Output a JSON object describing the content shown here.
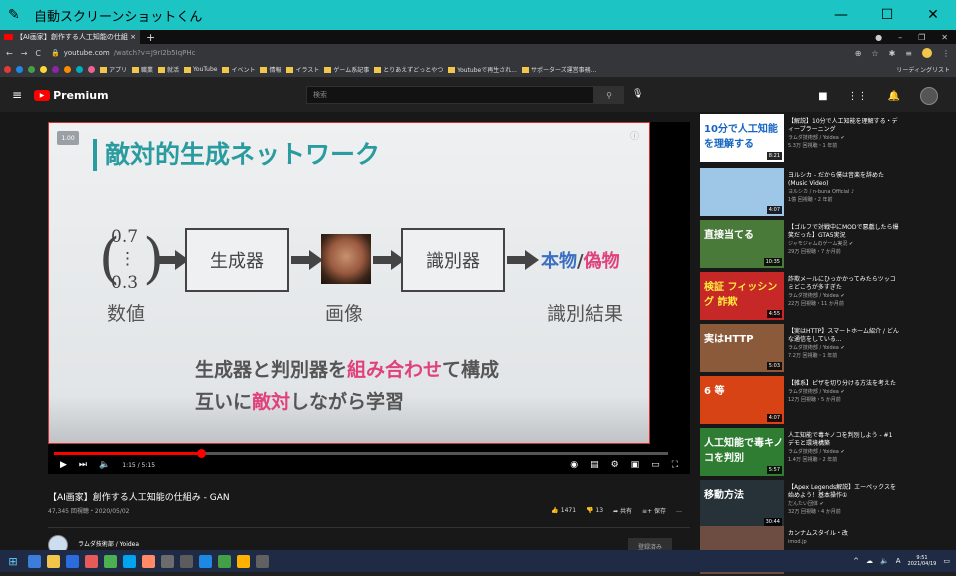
{
  "window": {
    "title": "自動スクリーンショットくん",
    "icon": "feather-icon",
    "minimize": "—",
    "maximize": "☐",
    "close": "✕"
  },
  "browser": {
    "tab_title": "【AI画家】創作する人工知能の仕組 ×",
    "url_domain": "youtube.com",
    "url_path": "/watch?v=J9rI2b5IqPHc",
    "new_tab": "+",
    "bookmarks": [
      "アプリ",
      "職業",
      "就活",
      "YouTube",
      "イベント",
      "情報",
      "イラスト",
      "ゲーム系記事",
      "とりあえずどっとやつ",
      "Youtubeで再生され...",
      "サポーターズ運営事務..."
    ],
    "reading_list": "リーディングリスト"
  },
  "youtube": {
    "logo": "Premium",
    "search_placeholder": "検索",
    "video_title": "【AI画家】創作する人工知能の仕組み - GAN",
    "views_date": "47,345 回視聴・2020/05/02",
    "likes": "1471",
    "dislikes": "13",
    "share": "共有",
    "save": "保存",
    "more": "…",
    "channel": "ラムダ技術部 / Yoidea",
    "subscribe": "登録済み",
    "time": "1:15 / 5:15",
    "progress": 0.24
  },
  "slide": {
    "page_badge": "1.00",
    "title": "敵対的生成ネットワーク",
    "vector": [
      "0.7",
      "⋮",
      "0.3"
    ],
    "generator": "生成器",
    "discriminator": "識別器",
    "real": "本物",
    "slash": "/",
    "fake": "偽物",
    "label_number": "数値",
    "label_image": "画像",
    "label_result": "識別結果",
    "line1_a": "生成器と判別器を",
    "line1_b": "組み合わせ",
    "line1_c": "て構成",
    "line2_a": "互いに",
    "line2_b": "敵対",
    "line2_c": "しながら学習"
  },
  "sidebar": [
    {
      "title": "【解説】10分で人工知能を理解する・ディープラーニング",
      "channel": "ラムダ技術部 / Yoidea ✔",
      "meta": "5.3万 回視聴・1 年前",
      "duration": "8:21",
      "thumb_text": "10分で人工知能を理解する",
      "bg": "#ffffff",
      "fg": "#1565c0"
    },
    {
      "title": "ヨルシカ - だから僕は音楽を辞めた (Music Video)",
      "channel": "ヨルシカ / n-buna Official ♪",
      "meta": "1億 回視聴・2 年前",
      "duration": "4:07",
      "thumb_text": "",
      "bg": "#9ec6e6",
      "fg": "#fff"
    },
    {
      "title": "【ゴルフで対戦中にMODで悪戯したら爆笑だった】GTA5実況",
      "channel": "ジャモジャムのゲーム実況 ✔",
      "meta": "29万 回視聴・7 か月前",
      "duration": "10:35",
      "thumb_text": "直接当てる",
      "bg": "#4a7a3a",
      "fg": "#fff"
    },
    {
      "title": "詐欺メールにひっかかってみたらツッコミどころが多すぎた",
      "channel": "ラムダ技術部 / Yoidea ✔",
      "meta": "22万 回視聴・11 か月前",
      "duration": "4:55",
      "thumb_text": "検証 フィッシング 詐欺",
      "bg": "#c62828",
      "fg": "#ffeb3b"
    },
    {
      "title": "【実はHTTP】スマートホーム紹介 / どんな通信をしている...",
      "channel": "ラムダ技術部 / Yoidea ✔",
      "meta": "7.2万 回視聴・1 年前",
      "duration": "5:03",
      "thumb_text": "実はHTTP",
      "bg": "#8a5a3a",
      "fg": "#fff"
    },
    {
      "title": "【雑系】ピザを切り分ける方法を考えた",
      "channel": "ラムダ技術部 / Yoidea ✔",
      "meta": "12万 回視聴・5 か月前",
      "duration": "4:07",
      "thumb_text": "6 等",
      "bg": "#d84315",
      "fg": "#fff"
    },
    {
      "title": "人工知能で毒キノコを判別しよう - #1 デモと環境構築",
      "channel": "ラムダ技術部 / Yoidea ✔",
      "meta": "1.4万 回視聴・2 年前",
      "duration": "5:57",
      "thumb_text": "人工知能で毒キノコを判別",
      "bg": "#2e7d32",
      "fg": "#fff"
    },
    {
      "title": "【Apex Legends解説】エーペックスを始めよう！基本操作①",
      "channel": "だんたい団体 ✔",
      "meta": "32万 回視聴・4 か月前",
      "duration": "30:44",
      "thumb_text": "移動方法",
      "bg": "#263238",
      "fg": "#fff"
    },
    {
      "title": "カンナムスタイル・改",
      "channel": "imod.jp",
      "meta": "",
      "duration": "",
      "thumb_text": "",
      "bg": "#6d4c41",
      "fg": "#fff"
    }
  ],
  "taskbar": {
    "time": "9:51",
    "date": "2021/04/19",
    "ime": "A"
  }
}
